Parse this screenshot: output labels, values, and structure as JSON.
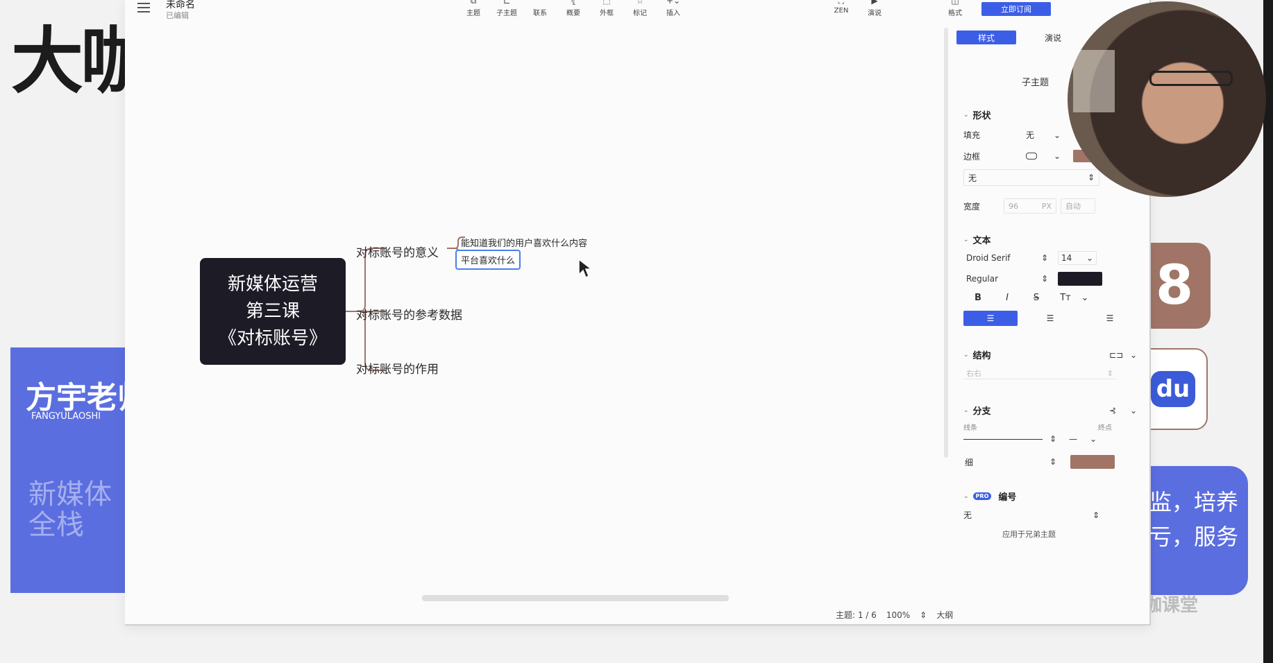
{
  "background": {
    "brand_text": "大咖",
    "left_card": {
      "title": "方宇老师",
      "subtitle": "FANGYULAOSHI",
      "faded_text": "新媒体全栈"
    },
    "right_icon_1": "8",
    "right_icon_2": "du",
    "right_card_lines": [
      "监，培养",
      "亏，服务"
    ],
    "watermark": "大咖课堂"
  },
  "app": {
    "doc_title": "未命名",
    "doc_status": "已编辑",
    "toolbar_main": [
      {
        "label": "主题",
        "icon": "topic-icon",
        "glyph": "⧉"
      },
      {
        "label": "子主题",
        "icon": "subtopic-icon",
        "glyph": "⊏"
      },
      {
        "label": "联系",
        "icon": "relationship-icon",
        "glyph": "⌒"
      },
      {
        "label": "概要",
        "icon": "summary-icon",
        "glyph": "⦃"
      },
      {
        "label": "外框",
        "icon": "boundary-icon",
        "glyph": "⬚"
      },
      {
        "label": "标记",
        "icon": "marker-icon",
        "glyph": "☆"
      },
      {
        "label": "插入",
        "icon": "insert-icon",
        "glyph": "+⌄"
      }
    ],
    "toolbar_right": [
      {
        "label": "ZEN",
        "icon": "zen-icon",
        "glyph": "⛶"
      },
      {
        "label": "演说",
        "icon": "pitch-icon",
        "glyph": "▶"
      }
    ],
    "toolbar_format": {
      "label": "格式",
      "icon": "format-icon",
      "glyph": "◫"
    },
    "subscribe_label": "立即订阅",
    "mindmap": {
      "root_lines": [
        "新媒体运营",
        "第三课",
        "《对标账号》"
      ],
      "topics": [
        "对标账号的意义",
        "对标账号的参考数据",
        "对标账号的作用"
      ],
      "subtopics": [
        "能知道我们的用户喜欢什么内容",
        "平台喜欢什么"
      ]
    },
    "status": {
      "topic_count": "主题: 1 / 6",
      "zoom": "100%",
      "outline": "大纲"
    },
    "panel": {
      "tabs": [
        "样式",
        "演说"
      ],
      "subtopic_preview": "子主题",
      "shape": {
        "title": "形状",
        "fill_label": "填充",
        "fill_value": "无",
        "border_label": "边框",
        "border_color": "#a07567",
        "border_style_value": "无",
        "width_label": "宽度",
        "width_value": "96",
        "width_unit": "PX",
        "width_auto": "自动"
      },
      "text": {
        "title": "文本",
        "font": "Droid Serif",
        "size": "14",
        "weight": "Regular",
        "color": "#1d1b26",
        "bold": "B",
        "italic": "I",
        "strike": "S",
        "case": "Tт"
      },
      "structure": {
        "title": "结构",
        "value": "右右"
      },
      "branch": {
        "title": "分支",
        "line_label": "线条",
        "end_label": "终点",
        "thickness": "细",
        "color": "#a07567"
      },
      "numbering": {
        "pro_badge": "PRO",
        "title": "编号",
        "value": "无",
        "apply_text": "应用于兄弟主题"
      }
    }
  },
  "colors": {
    "accent": "#3c5ee6",
    "branch": "#a07567",
    "root_fill": "#1d1b26",
    "slide_blue": "#5b6ee0"
  }
}
